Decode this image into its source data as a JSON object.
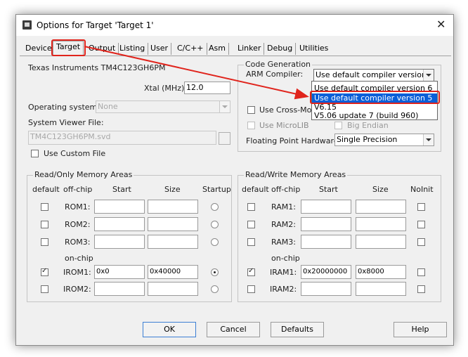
{
  "window": {
    "title": "Options for Target 'Target 1'"
  },
  "tabs": [
    "Device",
    "Target",
    "Output",
    "Listing",
    "User",
    "C/C++",
    "Asm",
    "Linker",
    "Debug",
    "Utilities"
  ],
  "target": {
    "device_name": "Texas Instruments TM4C123GH6PM",
    "xtal_label": "Xtal (MHz):",
    "xtal_value": "12.0",
    "os_label": "Operating system:",
    "os_value": "None",
    "svf_label": "System Viewer File:",
    "svf_value": "TM4C123GH6PM.svd",
    "custom_file_label": "Use Custom File"
  },
  "codegen": {
    "title": "Code Generation",
    "compiler_label": "ARM Compiler:",
    "compiler_value": "Use default compiler version 5",
    "options": [
      "Use default compiler version 6",
      "Use default compiler version 5",
      "V6.15",
      "V5.06 update 7 (build 960)"
    ],
    "selected_option": 1,
    "cross_module_label": "Use Cross-Module",
    "microlib_label": "Use MicroLIB",
    "big_endian_label": "Big Endian",
    "fph_label": "Floating Point Hardware:",
    "fph_value": "Single Precision"
  },
  "rom": {
    "title": "Read/Only Memory Areas",
    "headers": {
      "default": "default",
      "offchip": "off-chip",
      "start": "Start",
      "size": "Size",
      "startup": "Startup"
    },
    "onchip_label": "on-chip",
    "rows": [
      {
        "name": "ROM1:",
        "start": "",
        "size": ""
      },
      {
        "name": "ROM2:",
        "start": "",
        "size": ""
      },
      {
        "name": "ROM3:",
        "start": "",
        "size": ""
      },
      {
        "name": "IROM1:",
        "start": "0x0",
        "size": "0x40000"
      },
      {
        "name": "IROM2:",
        "start": "",
        "size": ""
      }
    ]
  },
  "ram": {
    "title": "Read/Write Memory Areas",
    "headers": {
      "default": "default",
      "offchip": "off-chip",
      "start": "Start",
      "size": "Size",
      "noinit": "NoInit"
    },
    "onchip_label": "on-chip",
    "rows": [
      {
        "name": "RAM1:",
        "start": "",
        "size": ""
      },
      {
        "name": "RAM2:",
        "start": "",
        "size": ""
      },
      {
        "name": "RAM3:",
        "start": "",
        "size": ""
      },
      {
        "name": "IRAM1:",
        "start": "0x20000000",
        "size": "0x8000"
      },
      {
        "name": "IRAM2:",
        "start": "",
        "size": ""
      }
    ]
  },
  "buttons": {
    "ok": "OK",
    "cancel": "Cancel",
    "defaults": "Defaults",
    "help": "Help"
  },
  "colors": {
    "annotation": "#e0241c",
    "selection": "#0a5fd8"
  }
}
